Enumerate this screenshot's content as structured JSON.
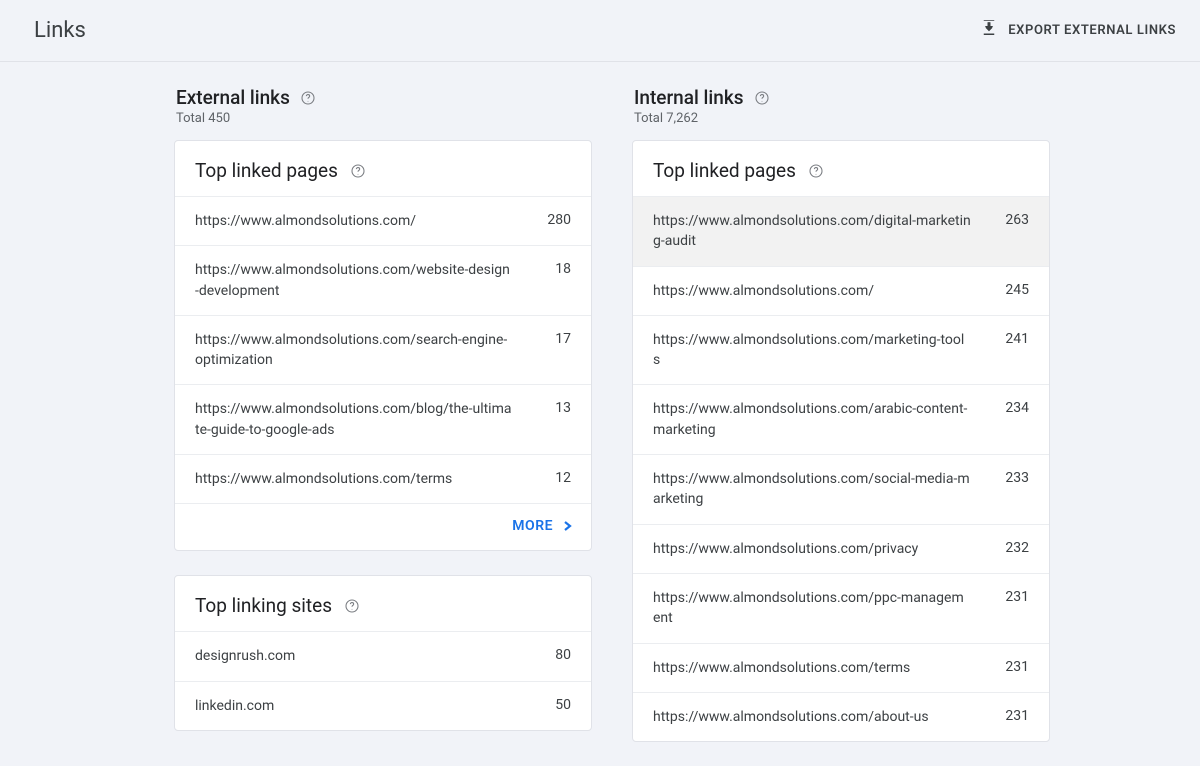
{
  "header": {
    "title": "Links",
    "export_label": "EXPORT EXTERNAL LINKS"
  },
  "external": {
    "title": "External links",
    "subtitle": "Total 450",
    "top_linked_pages": {
      "title": "Top linked pages",
      "more_label": "MORE",
      "rows": [
        {
          "url": "https://www.almondsolutions.com/",
          "count": "280"
        },
        {
          "url": "https://www.almondsolutions.com/website-design-development",
          "count": "18"
        },
        {
          "url": "https://www.almondsolutions.com/search-engine-optimization",
          "count": "17"
        },
        {
          "url": "https://www.almondsolutions.com/blog/the-ultimate-guide-to-google-ads",
          "count": "13"
        },
        {
          "url": "https://www.almondsolutions.com/terms",
          "count": "12"
        }
      ]
    },
    "top_linking_sites": {
      "title": "Top linking sites",
      "rows": [
        {
          "url": "designrush.com",
          "count": "80"
        },
        {
          "url": "linkedin.com",
          "count": "50"
        }
      ]
    }
  },
  "internal": {
    "title": "Internal links",
    "subtitle": "Total 7,262",
    "top_linked_pages": {
      "title": "Top linked pages",
      "rows": [
        {
          "url": "https://www.almondsolutions.com/digital-marketing-audit",
          "count": "263",
          "highlight": true
        },
        {
          "url": "https://www.almondsolutions.com/",
          "count": "245"
        },
        {
          "url": "https://www.almondsolutions.com/marketing-tools",
          "count": "241"
        },
        {
          "url": "https://www.almondsolutions.com/arabic-content-marketing",
          "count": "234"
        },
        {
          "url": "https://www.almondsolutions.com/social-media-marketing",
          "count": "233"
        },
        {
          "url": "https://www.almondsolutions.com/privacy",
          "count": "232"
        },
        {
          "url": "https://www.almondsolutions.com/ppc-management",
          "count": "231"
        },
        {
          "url": "https://www.almondsolutions.com/terms",
          "count": "231"
        },
        {
          "url": "https://www.almondsolutions.com/about-us",
          "count": "231"
        }
      ]
    }
  }
}
